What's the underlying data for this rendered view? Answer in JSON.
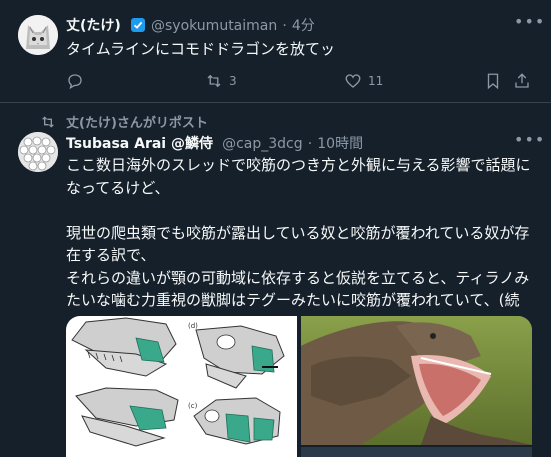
{
  "tweet1": {
    "display_name": "丈(たけ)",
    "handle": "@syokumutaiman",
    "time": "4分",
    "text": "タイムラインにコモドドラゴンを放てッ",
    "retweets": "3",
    "likes": "11"
  },
  "repost_label": "丈(たけ)さんがリポスト",
  "tweet2": {
    "display_name": "Tsubasa Arai @鱗侍",
    "handle": "@cap_3dcg",
    "time": "10時間",
    "lines": [
      "ここ数日海外のスレッドで咬筋のつき方と外観に与える影響で話題に",
      "なってるけど、",
      "",
      "現世の爬虫類でも咬筋が露出している奴と咬筋が覆われている奴が存",
      "在する訳で、",
      "それらの違いが顎の可動域に依存すると仮説を立てると、ティラノみ",
      "たいな噛む力重視の獣脚はテグーみたいに咬筋が覆われていて、(続"
    ],
    "figure_labels": [
      "(b)",
      "(d)",
      "(c)"
    ],
    "accent_muscle_color": "#3aa88a"
  },
  "colors": {
    "background": "#15202b",
    "accent": "#1d9bf0"
  }
}
